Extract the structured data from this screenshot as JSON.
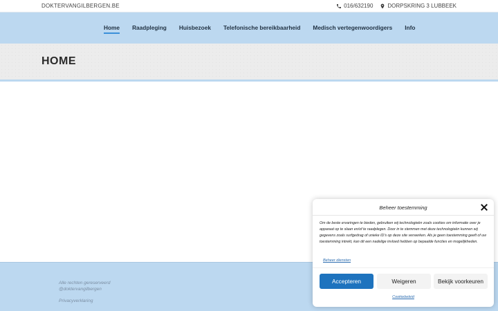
{
  "topbar": {
    "site_name": "DOKTERVANGILBERGEN.BE",
    "phone": "016/632190",
    "address": "DORPSKRING 3 LUBBEEK"
  },
  "nav": {
    "items": [
      {
        "label": "Home",
        "active": true
      },
      {
        "label": "Raadpleging"
      },
      {
        "label": "Huisbezoek"
      },
      {
        "label": "Telefonische bereikbaarheid"
      },
      {
        "label": "Medisch vertegenwoordigers"
      },
      {
        "label": "Info"
      }
    ]
  },
  "page": {
    "title": "HOME"
  },
  "footer": {
    "rights_line1": "Alle rechten gereserveerd",
    "rights_line2": "@doktervangilbergen",
    "privacy": "Privacyverklaring"
  },
  "cookie": {
    "title": "Beheer toestemming",
    "text": "Om de beste ervaringen te bieden, gebruiken wij technologieën zoals cookies om informatie over je apparaat op te slaan en/of te raadplegen. Door in te stemmen met deze technologieën kunnen wij gegevens zoals surfgedrag of unieke ID's op deze site verwerken. Als je geen toestemming geeft of uw toestemming intrekt, kan dit een nadelige invloed hebben op bepaalde functies en mogelijkheden.",
    "manage": "Beheer diensten",
    "accept": "Accepteren",
    "deny": "Weigeren",
    "preferences": "Bekijk voorkeuren",
    "policy": "Cookiebeleid"
  },
  "colors": {
    "nav_bg": "#bcd8f0",
    "accent": "#1e73be",
    "active_underline": "#3a8fd9"
  }
}
